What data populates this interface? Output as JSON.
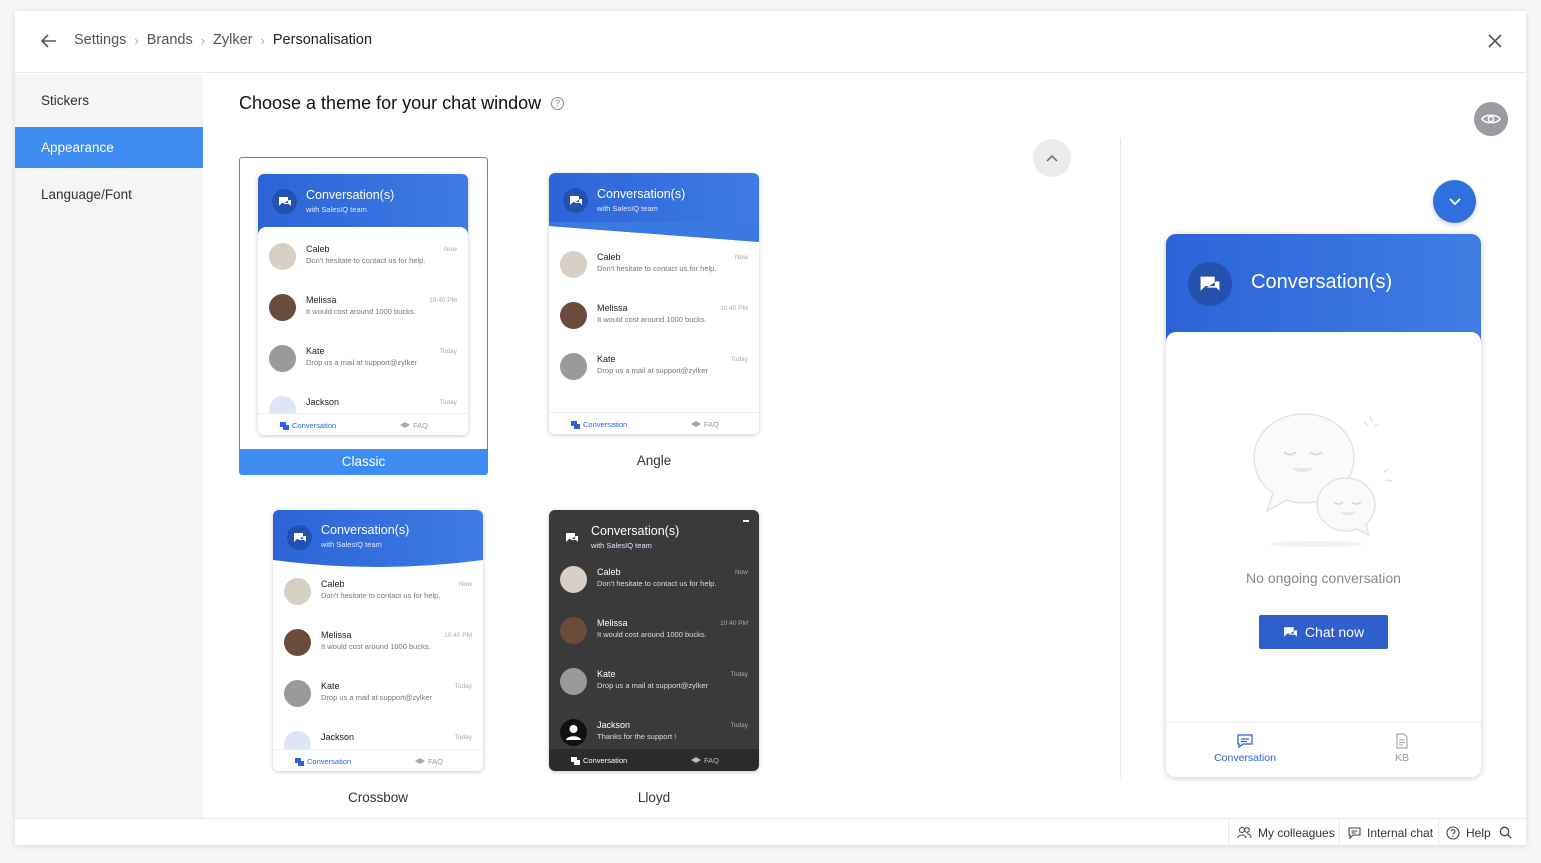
{
  "breadcrumb": {
    "items": [
      "Settings",
      "Brands",
      "Zylker",
      "Personalisation"
    ]
  },
  "sidebar": {
    "items": [
      {
        "label": "Stickers"
      },
      {
        "label": "Appearance"
      },
      {
        "label": "Language/Font"
      }
    ]
  },
  "main": {
    "title": "Choose a theme for your chat window"
  },
  "card": {
    "title": "Conversation(s)",
    "subtitle": "with SalesIQ team",
    "footer_conversation": "Conversation",
    "footer_faq": "FAQ",
    "messages": [
      {
        "name": "Caleb",
        "text": "Don't hesitate to contact us for help.",
        "time": "Now"
      },
      {
        "name": "Melissa",
        "text": "It would cost around 1000 bucks.",
        "time": "10:40 PM"
      },
      {
        "name": "Kate",
        "text": "Drop us a mail at support@zylker",
        "time": "Today"
      },
      {
        "name": "Jackson",
        "text": "Thanks for the support !",
        "time": "Today"
      }
    ]
  },
  "themes": [
    {
      "label": "Classic",
      "selected": true
    },
    {
      "label": "Angle",
      "selected": false
    },
    {
      "label": "Crossbow",
      "selected": false
    },
    {
      "label": "Lloyd",
      "selected": false
    }
  ],
  "preview": {
    "title": "Conversation(s)",
    "empty_text": "No ongoing conversation",
    "chat_button": "Chat now",
    "tabs": [
      {
        "label": "Conversation",
        "icon": "chat-bubble-icon"
      },
      {
        "label": "KB",
        "icon": "document-icon"
      }
    ]
  },
  "bottombar": {
    "colleagues": "My colleagues",
    "internal_chat": "Internal chat",
    "help": "Help"
  },
  "colors": {
    "accent": "#3f8cf3",
    "brand_blue": "#2c64d8",
    "dark_theme": "#3a3a3a"
  }
}
